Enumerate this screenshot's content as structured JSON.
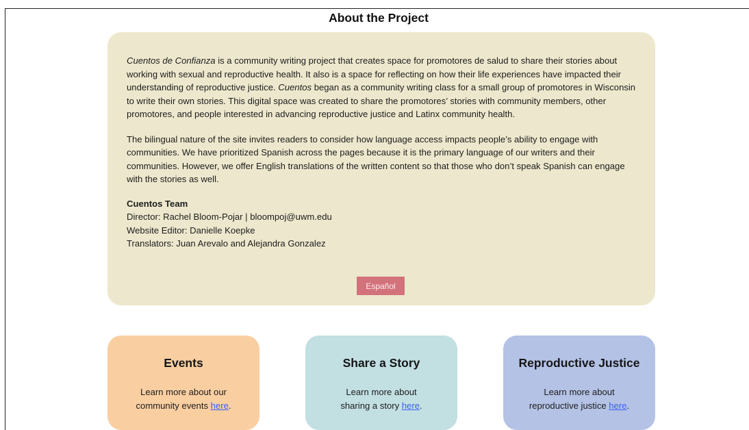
{
  "page_title": "About the Project",
  "about": {
    "para1_italic_start": "Cuentos de Confianza",
    "para1_a": " is a community writing project that creates space for promotores de salud to share their stories about working with sexual and reproductive health. It also is a space for reflecting on how their life experiences have impacted their understanding of reproductive justice. ",
    "para1_italic_mid": "Cuentos",
    "para1_b": " began as a community writing class for a small group of promotores in Wisconsin to write their own stories. This digital space was created to share the promotores’ stories with community members, other promotores, and people interested in advancing reproductive justice and Latinx community health.",
    "para2": "The bilingual nature of the site invites readers to consider how language access impacts people’s ability to engage with communities. We have prioritized Spanish across the pages because it is the primary language of our writers and their communities. However, we offer English translations of the written content so that those who don’t speak Spanish can engage with the stories as well.",
    "team_heading": "Cuentos Team",
    "team_director": "Director: Rachel Bloom-Pojar | bloompoj@uwm.edu",
    "team_editor": "Website Editor: Danielle Koepke",
    "team_translators": "Translators: Juan Arevalo and Alejandra Gonzalez",
    "language_button": "Español"
  },
  "tiles": [
    {
      "title": "Events",
      "text_line1": "Learn more about our",
      "text_line2": "community events ",
      "link": "here",
      "suffix": ".",
      "color": "#f9cea1"
    },
    {
      "title": "Share a Story",
      "text_line1": "Learn more about",
      "text_line2": "sharing a story ",
      "link": "here",
      "suffix": ".",
      "color": "#c2dfe2"
    },
    {
      "title": "Reproductive Justice",
      "text_line1": "Learn more about",
      "text_line2": "reproductive justice ",
      "link": "here",
      "suffix": ".",
      "color": "#b4c2e6"
    }
  ],
  "colors": {
    "about_background": "#ede8cd",
    "button_background": "#d2727b",
    "link": "#3b5ff0"
  }
}
